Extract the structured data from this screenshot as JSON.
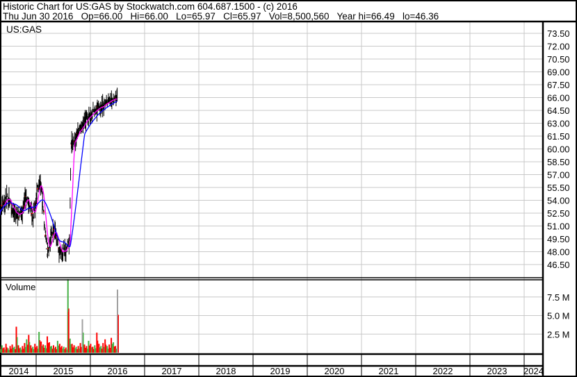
{
  "header": {
    "title": "Historic Chart for US:GAS by Stockwatch.com 604.687.1500 - (c) 2016",
    "quote": "Thu Jun 30 2016   Op=66.00   Hi=66.00   Lo=65.97   Cl=65.97   Vol=8,500,560   Year hi=66.49   lo=46.36"
  },
  "colors": {
    "candle": "#000000",
    "down": "#ff0000",
    "ma_short": "#ff00ff",
    "ma_long": "#0000ff",
    "vol_up": "#44b044",
    "vol_down": "#ff0000",
    "vol_flat": "#a0a0a0",
    "grid": "#c8c8c8"
  },
  "chart_data": {
    "type": "line",
    "symbol_label": "US:GAS",
    "volume_label": "Volume",
    "y_ticks": [
      "73.50",
      "72.00",
      "70.50",
      "69.00",
      "67.50",
      "66.00",
      "64.50",
      "63.00",
      "61.50",
      "60.00",
      "58.50",
      "57.00",
      "55.50",
      "54.00",
      "52.50",
      "51.00",
      "49.50",
      "48.00",
      "46.50"
    ],
    "ylim": [
      45.0,
      74.5
    ],
    "volume_ticks": [
      "7.5 M",
      "5.0 M",
      "2.5 M"
    ],
    "volume_tick_values": [
      7.5,
      5.0,
      2.5
    ],
    "x_years": [
      "2014",
      "2015",
      "2016",
      "2017",
      "2018",
      "2019",
      "2020",
      "2021",
      "2022",
      "2023",
      "2024"
    ],
    "price_keypoints": [
      [
        2014.33,
        52.8
      ],
      [
        2014.46,
        54.3
      ],
      [
        2014.55,
        53.1
      ],
      [
        2014.64,
        52.3
      ],
      [
        2014.74,
        52.7
      ],
      [
        2014.8,
        54.3
      ],
      [
        2014.89,
        53.1
      ],
      [
        2014.95,
        52.3
      ],
      [
        2015.07,
        56.7
      ],
      [
        2015.13,
        53.1
      ],
      [
        2015.17,
        49.8
      ],
      [
        2015.21,
        47.8
      ],
      [
        2015.26,
        49.4
      ],
      [
        2015.31,
        50.6
      ],
      [
        2015.36,
        49.8
      ],
      [
        2015.42,
        48.2
      ],
      [
        2015.49,
        47.8
      ],
      [
        2015.55,
        48.2
      ],
      [
        2015.62,
        49.4
      ],
      [
        2015.64,
        60.4
      ],
      [
        2015.72,
        61.2
      ],
      [
        2015.81,
        62.4
      ],
      [
        2015.9,
        63.2
      ],
      [
        2016.0,
        64.0
      ],
      [
        2016.09,
        64.6
      ],
      [
        2016.19,
        64.8
      ],
      [
        2016.28,
        65.2
      ],
      [
        2016.36,
        65.6
      ],
      [
        2016.45,
        65.8
      ],
      [
        2016.5,
        65.97
      ]
    ],
    "volume_millions": [
      0.8,
      1.0,
      0.7,
      1.2,
      0.6,
      0.9,
      1.1,
      0.8,
      3.5,
      1.0,
      0.7,
      0.9,
      1.3,
      1.8,
      2.4,
      1.0,
      0.8,
      1.2,
      0.9,
      2.8,
      1.5,
      1.1,
      1.0,
      2.2,
      1.4,
      0.9,
      1.0,
      0.8,
      1.6,
      1.2,
      0.9,
      0.8,
      0.7,
      9.9,
      1.9,
      1.2,
      1.0,
      0.8,
      0.9,
      1.3,
      4.5,
      1.1,
      0.9,
      1.6,
      1.2,
      0.8,
      1.0,
      2.7,
      1.2,
      0.9,
      1.3,
      1.8,
      0.9,
      1.1,
      2.0,
      1.4,
      0.9,
      8.5
    ],
    "volume_spike_index_red": 33,
    "volume_spike_red_value": 5.5
  }
}
